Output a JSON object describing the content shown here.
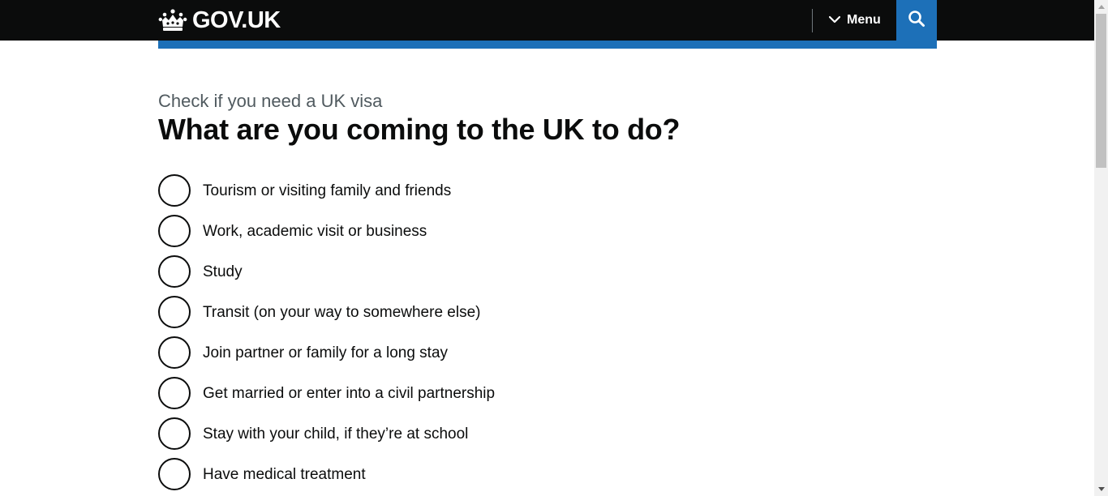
{
  "header": {
    "logo_text": "GOV.UK",
    "menu_label": "Menu",
    "search_label": "Search",
    "colors": {
      "background": "#0b0c0c",
      "accent": "#1d70b8"
    }
  },
  "main": {
    "caption": "Check if you need a UK visa",
    "heading": "What are you coming to the UK to do?",
    "options": [
      {
        "label": "Tourism or visiting family and friends",
        "selected": false
      },
      {
        "label": "Work, academic visit or business",
        "selected": false
      },
      {
        "label": "Study",
        "selected": false
      },
      {
        "label": "Transit (on your way to somewhere else)",
        "selected": false
      },
      {
        "label": "Join partner or family for a long stay",
        "selected": false
      },
      {
        "label": "Get married or enter into a civil partnership",
        "selected": false
      },
      {
        "label": "Stay with your child, if they’re at school",
        "selected": false
      },
      {
        "label": "Have medical treatment",
        "selected": false
      }
    ]
  }
}
